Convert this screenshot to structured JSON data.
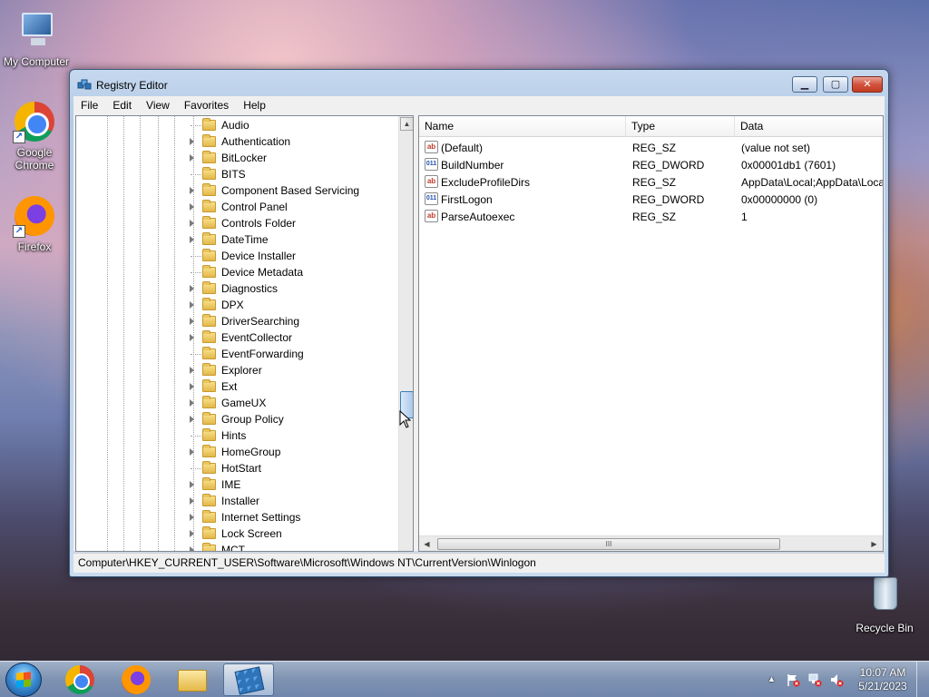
{
  "desktop": {
    "icons": [
      {
        "label": "My Computer"
      },
      {
        "label": "Google\nChrome"
      },
      {
        "label": "Firefox"
      },
      {
        "label": "Recycle Bin"
      }
    ]
  },
  "window": {
    "title": "Registry Editor",
    "minimize": "▁",
    "maximize": "▢",
    "close": "✕"
  },
  "menu": [
    "File",
    "Edit",
    "View",
    "Favorites",
    "Help"
  ],
  "tree": {
    "items": [
      {
        "label": "Audio",
        "expandable": false
      },
      {
        "label": "Authentication",
        "expandable": true
      },
      {
        "label": "BitLocker",
        "expandable": true
      },
      {
        "label": "BITS",
        "expandable": false
      },
      {
        "label": "Component Based Servicing",
        "expandable": true
      },
      {
        "label": "Control Panel",
        "expandable": true
      },
      {
        "label": "Controls Folder",
        "expandable": true
      },
      {
        "label": "DateTime",
        "expandable": true
      },
      {
        "label": "Device Installer",
        "expandable": false
      },
      {
        "label": "Device Metadata",
        "expandable": false
      },
      {
        "label": "Diagnostics",
        "expandable": true
      },
      {
        "label": "DPX",
        "expandable": true
      },
      {
        "label": "DriverSearching",
        "expandable": true
      },
      {
        "label": "EventCollector",
        "expandable": true
      },
      {
        "label": "EventForwarding",
        "expandable": false
      },
      {
        "label": "Explorer",
        "expandable": true
      },
      {
        "label": "Ext",
        "expandable": true
      },
      {
        "label": "GameUX",
        "expandable": true
      },
      {
        "label": "Group Policy",
        "expandable": true
      },
      {
        "label": "Hints",
        "expandable": false
      },
      {
        "label": "HomeGroup",
        "expandable": true
      },
      {
        "label": "HotStart",
        "expandable": false
      },
      {
        "label": "IME",
        "expandable": true
      },
      {
        "label": "Installer",
        "expandable": true
      },
      {
        "label": "Internet Settings",
        "expandable": true
      },
      {
        "label": "Lock Screen",
        "expandable": true
      },
      {
        "label": "MCT",
        "expandable": true
      }
    ],
    "scroll_position": 0.66
  },
  "list": {
    "columns": [
      "Name",
      "Type",
      "Data"
    ],
    "rows": [
      {
        "icon": "string-value-icon",
        "name": "(Default)",
        "type": "REG_SZ",
        "data": "(value not set)"
      },
      {
        "icon": "dword-value-icon",
        "name": "BuildNumber",
        "type": "REG_DWORD",
        "data": "0x00001db1 (7601)"
      },
      {
        "icon": "string-value-icon",
        "name": "ExcludeProfileDirs",
        "type": "REG_SZ",
        "data": "AppData\\Local;AppData\\Local"
      },
      {
        "icon": "dword-value-icon",
        "name": "FirstLogon",
        "type": "REG_DWORD",
        "data": "0x00000000 (0)"
      },
      {
        "icon": "string-value-icon",
        "name": "ParseAutoexec",
        "type": "REG_SZ",
        "data": "1"
      }
    ],
    "hscroll_thumb_label": "III"
  },
  "statusbar": {
    "path": "Computer\\HKEY_CURRENT_USER\\Software\\Microsoft\\Windows NT\\CurrentVersion\\Winlogon"
  },
  "taskbar": {
    "items": [
      "chrome",
      "firefox",
      "explorer",
      "regedit"
    ],
    "tray": {
      "chevron": "▲"
    },
    "clock": {
      "time": "10:07 AM",
      "date": "5/21/2023"
    }
  }
}
